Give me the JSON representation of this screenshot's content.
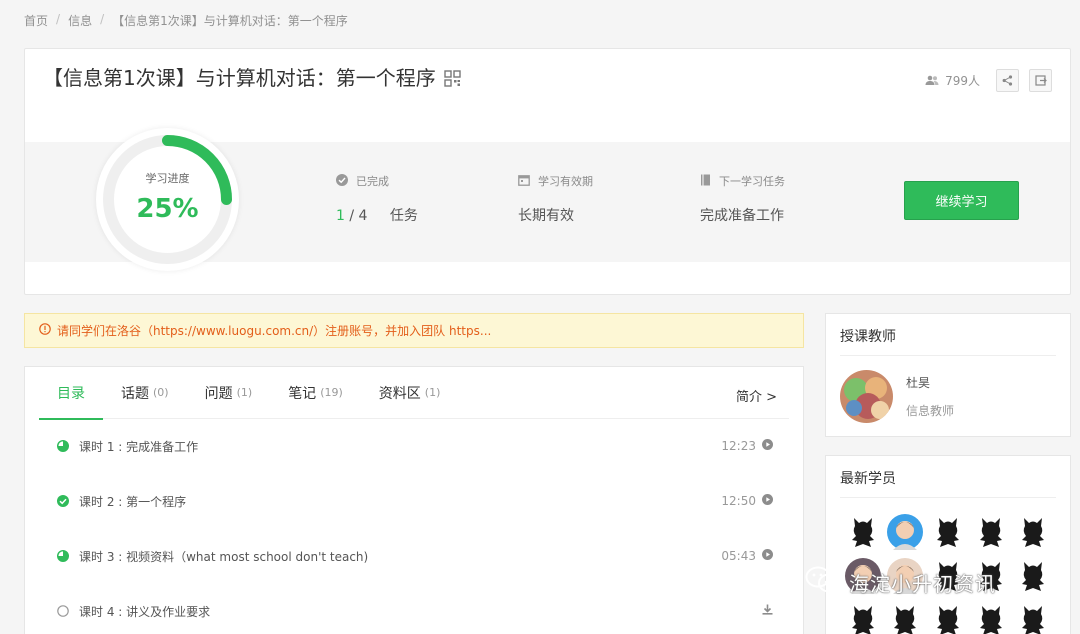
{
  "breadcrumb": {
    "home": "首页",
    "category": "信息",
    "current": "【信息第1次课】与计算机对话：第一个程序"
  },
  "course": {
    "title": "【信息第1次课】与计算机对话：第一个程序",
    "members": "799人",
    "progress_label": "学习进度",
    "progress_value": "25%",
    "progress_fraction": 0.25,
    "completed_label": "已完成",
    "completed_done": "1",
    "completed_total": "/ 4",
    "completed_unit": "任务",
    "validity_label": "学习有效期",
    "validity_value": "长期有效",
    "next_label": "下一学习任务",
    "next_value": "完成准备工作",
    "continue_label": "继续学习"
  },
  "notice": {
    "text": "请同学们在洛谷（https://www.luogu.com.cn/）注册账号，并加入团队 https..."
  },
  "tabs": [
    {
      "label": "目录",
      "count": ""
    },
    {
      "label": "话题",
      "count": "(0)"
    },
    {
      "label": "问题",
      "count": "(1)"
    },
    {
      "label": "笔记",
      "count": "(19)"
    },
    {
      "label": "资料区",
      "count": "(1)"
    }
  ],
  "intro_link": "简介 >",
  "lessons": [
    {
      "title": "课时 1 : 完成准备工作",
      "duration": "12:23",
      "status": "half-icon",
      "action": "play-icon"
    },
    {
      "title": "课时 2 : 第一个程序",
      "duration": "12:50",
      "status": "check-icon",
      "action": "play-icon"
    },
    {
      "title": "课时 3 : 视频资料（what most school don't teach)",
      "duration": "05:43",
      "status": "half-icon",
      "action": "play-icon"
    },
    {
      "title": "课时 4 : 讲义及作业要求",
      "duration": "",
      "status": "empty-circle-icon",
      "action": "download-icon"
    }
  ],
  "teacher": {
    "section_title": "授课教师",
    "name": "杜昊",
    "role": "信息教师"
  },
  "students": {
    "section_title": "最新学员"
  },
  "watermark": "海淀小升初资讯",
  "colors": {
    "accent": "#2fbb5a",
    "notice_text": "#e35e1a",
    "notice_bg": "#fdf7d5"
  }
}
